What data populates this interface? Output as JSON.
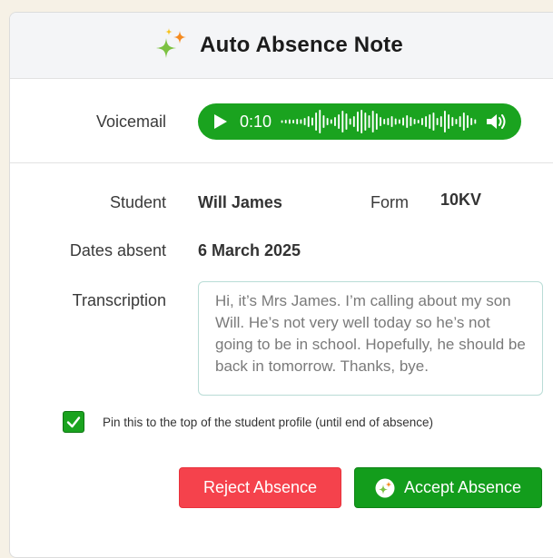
{
  "header": {
    "title": "Auto Absence Note",
    "icon": "sparkle-icon"
  },
  "voicemail": {
    "label": "Voicemail",
    "time": "0:10",
    "player_color": "#1aa31f"
  },
  "details": {
    "student_label": "Student",
    "student_value": "Will James",
    "form_label": "Form",
    "form_value": "10KV",
    "dates_label": "Dates absent",
    "dates_value": "6 March 2025",
    "transcription_label": "Transcription",
    "transcription_text": "Hi, it’s Mrs James. I’m calling about my son Will. He’s not very well today so he’s not going to be in school. Hopefully, he should be back in tomorrow. Thanks, bye."
  },
  "pin": {
    "checked": true,
    "label": "Pin this to the top of the student profile (until end of absence)"
  },
  "actions": {
    "reject_label": "Reject Absence",
    "accept_label": "Accept Absence",
    "reject_color": "#f5424c",
    "accept_color": "#139d1c"
  }
}
